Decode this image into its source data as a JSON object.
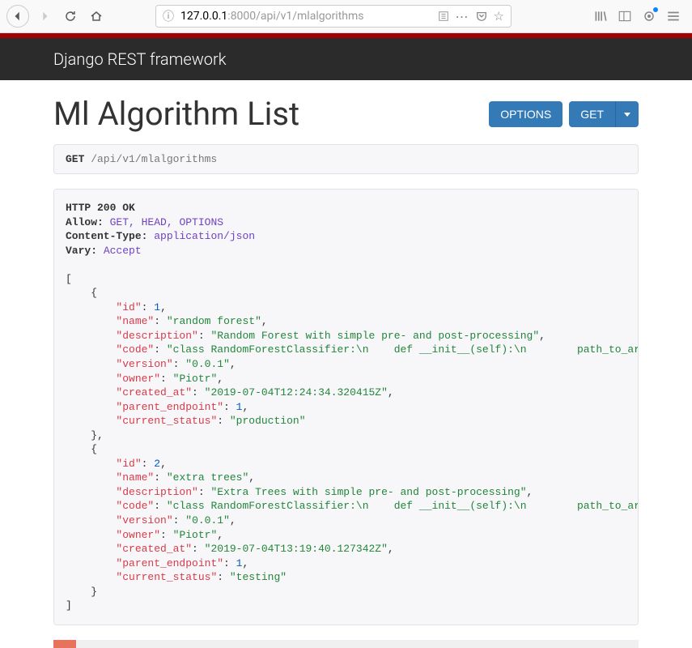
{
  "browser": {
    "url_prefix": "127.0.0.1",
    "url_suffix": ":8000/api/v1/mlalgorithms"
  },
  "header": {
    "brand": "Django REST framework"
  },
  "page": {
    "title": "Ml Algorithm List",
    "options_label": "OPTIONS",
    "get_label": "GET"
  },
  "request": {
    "method": "GET",
    "path": " /api/v1/mlalgorithms"
  },
  "response": {
    "status_line": "HTTP 200 OK",
    "headers": [
      {
        "name": "Allow:",
        "value": "GET, HEAD, OPTIONS"
      },
      {
        "name": "Content-Type:",
        "value": "application/json"
      },
      {
        "name": "Vary:",
        "value": "Accept"
      }
    ],
    "records": [
      {
        "id": 1,
        "name": "random forest",
        "description": "Random Forest with simple pre- and post-processing",
        "code": "class RandomForestClassifier:\\n    def __init__(self):\\n        path_to_artifacts = \\",
        "version": "0.0.1",
        "owner": "Piotr",
        "created_at": "2019-07-04T12:24:34.320415Z",
        "parent_endpoint": 1,
        "current_status": "production"
      },
      {
        "id": 2,
        "name": "extra trees",
        "description": "Extra Trees with simple pre- and post-processing",
        "code": "class RandomForestClassifier:\\n    def __init__(self):\\n        path_to_artifacts = \\",
        "version": "0.0.1",
        "owner": "Piotr",
        "created_at": "2019-07-04T13:19:40.127342Z",
        "parent_endpoint": 1,
        "current_status": "testing"
      }
    ]
  }
}
